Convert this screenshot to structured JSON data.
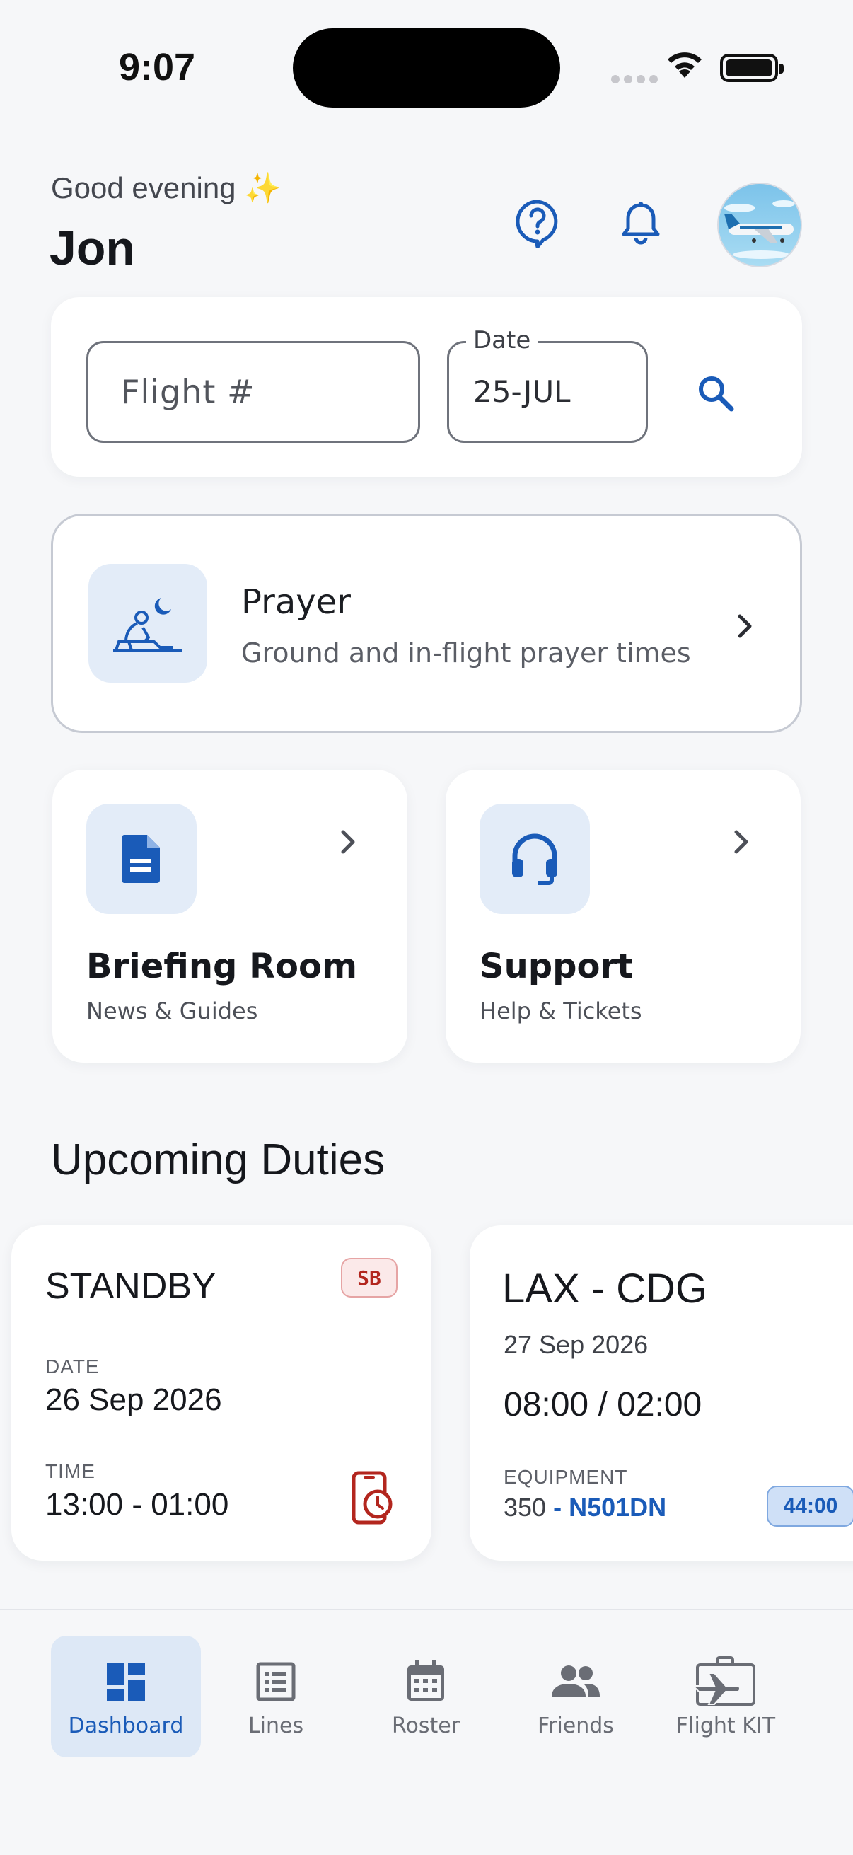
{
  "status_bar": {
    "time": "9:07"
  },
  "header": {
    "greeting": "Good evening ✨",
    "user_name": "Jon"
  },
  "flight_search": {
    "flight_placeholder": "Flight #",
    "date_label": "Date",
    "date_value": "25-JUL"
  },
  "prayer": {
    "title": "Prayer",
    "subtitle": "Ground and in-flight prayer times"
  },
  "quick_cards": [
    {
      "title": "Briefing Room",
      "subtitle": "News & Guides"
    },
    {
      "title": "Support",
      "subtitle": "Help & Tickets"
    }
  ],
  "upcoming": {
    "section_title": "Upcoming Duties",
    "standby": {
      "title": "STANDBY",
      "badge": "SB",
      "date_label": "DATE",
      "date_value": "26 Sep 2026",
      "time_label": "TIME",
      "time_value": "13:00 - 01:00"
    },
    "flight": {
      "route": "LAX - CDG",
      "date": "27 Sep 2026",
      "times": "08:00 / 02:00",
      "equipment_label": "EQUIPMENT",
      "equipment_type": "350",
      "equipment_sep": " - ",
      "registration": "N501DN",
      "duration": "44:00"
    }
  },
  "bottom_nav": [
    {
      "label": "Dashboard",
      "icon": "dashboard-icon",
      "active": true
    },
    {
      "label": "Lines",
      "icon": "list-icon",
      "active": false
    },
    {
      "label": "Roster",
      "icon": "calendar-icon",
      "active": false
    },
    {
      "label": "Friends",
      "icon": "people-icon",
      "active": false
    },
    {
      "label": "Flight KIT",
      "icon": "flight-bag-icon",
      "active": false
    }
  ],
  "colors": {
    "accent": "#1a5bb8",
    "danger": "#b3261e",
    "background": "#f6f7f9",
    "tile": "#e3ecf8"
  }
}
